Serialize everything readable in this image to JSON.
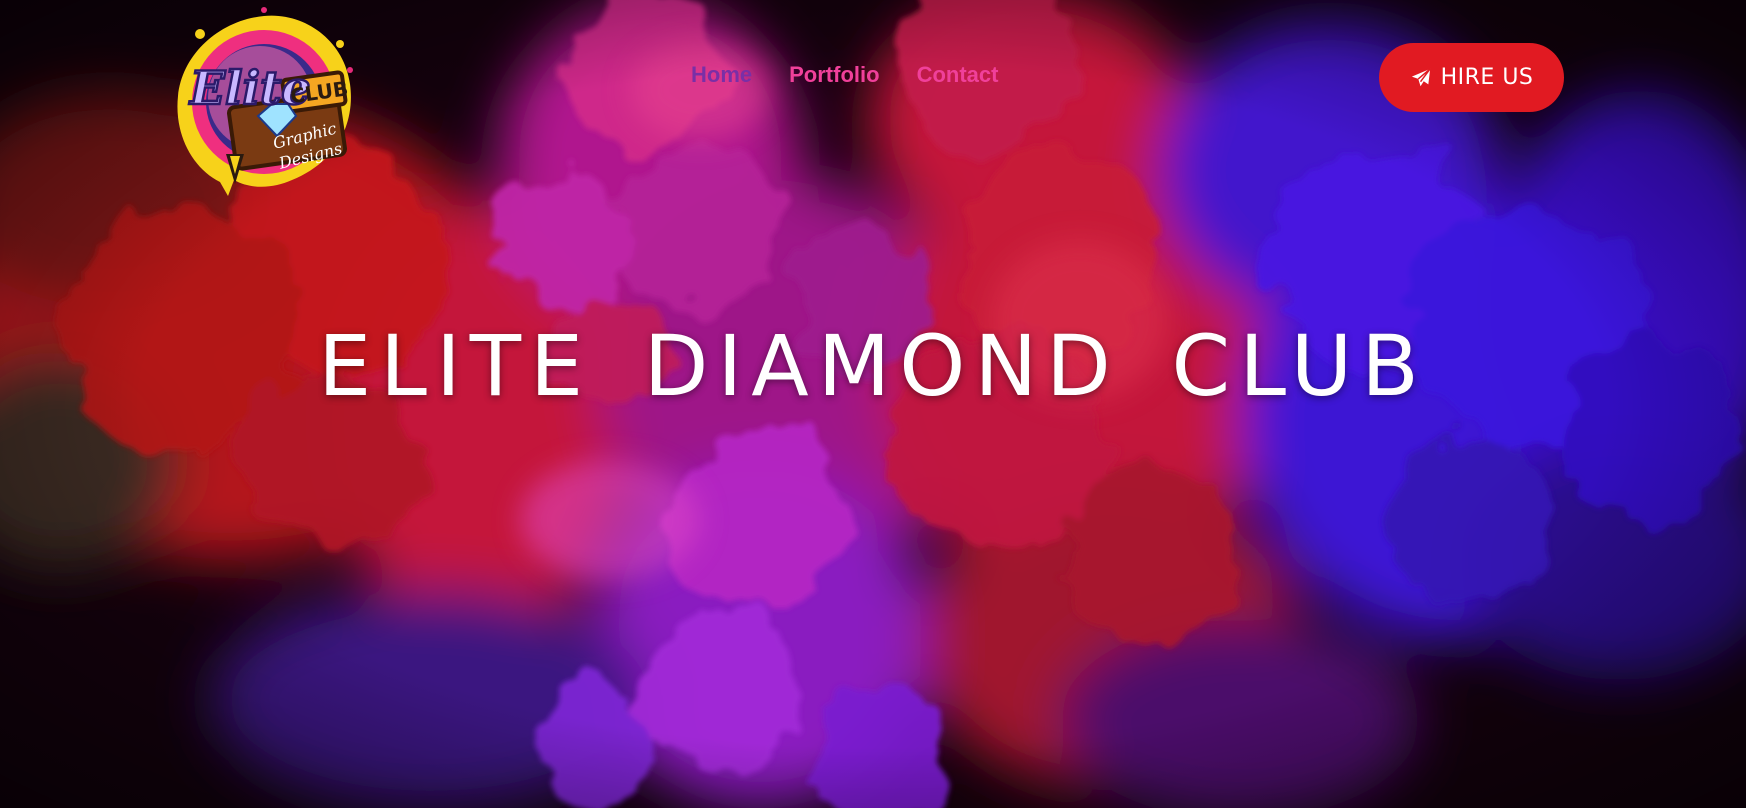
{
  "brand": {
    "logo_word": "Elite",
    "logo_badge": "CLUB",
    "logo_tag_1": "Graphic",
    "logo_tag_2": "Designs"
  },
  "nav": {
    "items": [
      {
        "label": "Home",
        "active": true
      },
      {
        "label": "Portfolio",
        "active": false
      },
      {
        "label": "Contact",
        "active": false
      }
    ]
  },
  "cta": {
    "label": "HIRE US",
    "icon": "paper-plane-icon",
    "color": "#e11a22"
  },
  "hero": {
    "title": "ELITE DIAMOND CLUB",
    "background": "smoke-cloud-image"
  },
  "colors": {
    "nav_active": "#7a2fa6",
    "nav_link": "#f0409a",
    "title": "#ffffff"
  }
}
